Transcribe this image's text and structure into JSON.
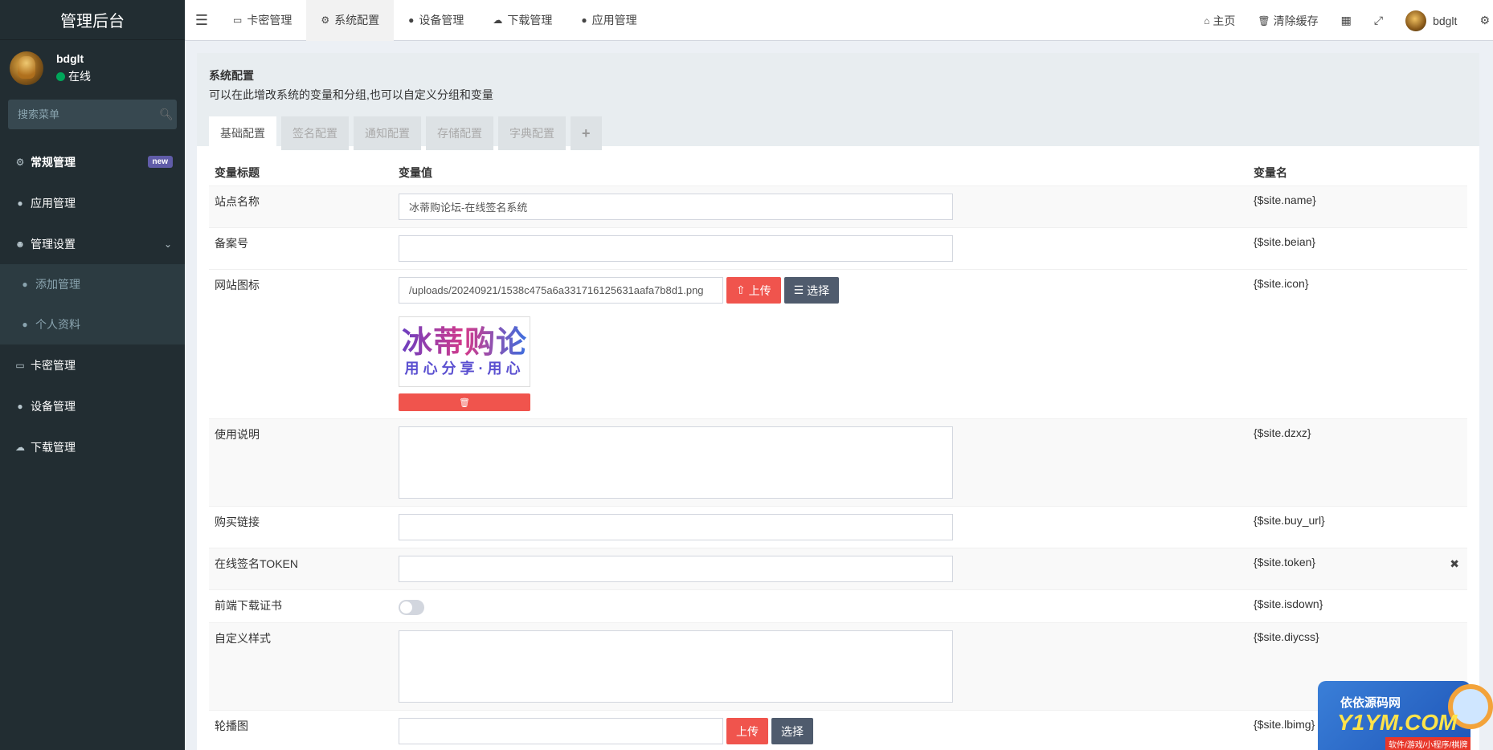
{
  "sidebar": {
    "logo": "管理后台",
    "user": {
      "name": "bdglt",
      "status": "在线"
    },
    "search": {
      "placeholder": "搜索菜单"
    },
    "items": [
      {
        "label": "常规管理",
        "badge": "new"
      },
      {
        "label": "应用管理"
      },
      {
        "label": "管理设置"
      },
      {
        "label": "添加管理"
      },
      {
        "label": "个人资料"
      },
      {
        "label": "卡密管理"
      },
      {
        "label": "设备管理"
      },
      {
        "label": "下载管理"
      }
    ]
  },
  "header": {
    "tabs": [
      "卡密管理",
      "系统配置",
      "设备管理",
      "下载管理",
      "应用管理"
    ],
    "right": {
      "home": "主页",
      "clear_cache": "清除缓存",
      "username": "bdglt"
    }
  },
  "panel": {
    "title": "系统配置",
    "desc": "可以在此增改系统的变量和分组,也可以自定义分组和变量",
    "tabs": [
      "基础配置",
      "签名配置",
      "通知配置",
      "存储配置",
      "字典配置"
    ],
    "plus": "+"
  },
  "table": {
    "headers": [
      "变量标题",
      "变量值",
      "变量名"
    ],
    "rows": [
      {
        "title": "站点名称",
        "value": "冰蒂购论坛-在线签名系统",
        "var": "{$site.name}"
      },
      {
        "title": "备案号",
        "value": "",
        "var": "{$site.beian}"
      },
      {
        "title": "网站图标",
        "value": "/uploads/20240921/1538c475a6a331716125631aafa7b8d1.png",
        "var": "{$site.icon}"
      },
      {
        "title": "使用说明",
        "value": "",
        "var": "{$site.dzxz}"
      },
      {
        "title": "购买链接",
        "value": "",
        "var": "{$site.buy_url}"
      },
      {
        "title": "在线签名TOKEN",
        "value": "",
        "var": "{$site.token}"
      },
      {
        "title": "前端下载证书",
        "value": "",
        "var": "{$site.isdown}"
      },
      {
        "title": "自定义样式",
        "value": "",
        "var": "{$site.diycss}"
      },
      {
        "title": "轮播图",
        "value": "",
        "var": "{$site.lbimg}"
      }
    ],
    "upload_label": "上传",
    "select_label": "选择",
    "preview": {
      "line1": "冰蒂购论",
      "line2": "用心分享·用心"
    }
  },
  "watermark": {
    "line1": "依依源码网",
    "line2": "Y1YM.COM",
    "line3": "软件/游戏/小程序/棋牌"
  }
}
